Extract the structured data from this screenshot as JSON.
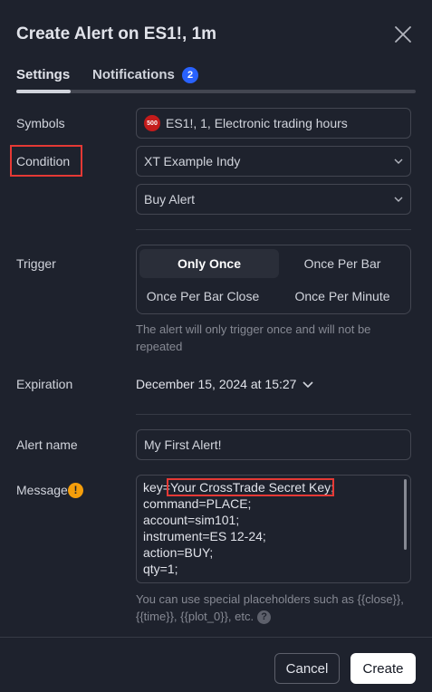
{
  "dialog": {
    "title": "Create Alert on ES1!, 1m",
    "close_icon": "close-icon"
  },
  "tabs": [
    {
      "label": "Settings",
      "active": true
    },
    {
      "label": "Notifications",
      "badge": "2"
    }
  ],
  "symbols": {
    "label": "Symbols",
    "logo_text": "500",
    "value": "ES1!, 1, Electronic trading hours"
  },
  "condition": {
    "label": "Condition",
    "value": "XT Example Indy",
    "sub_value": "Buy Alert"
  },
  "trigger": {
    "label": "Trigger",
    "options": [
      "Only Once",
      "Once Per Bar",
      "Once Per Bar Close",
      "Once Per Minute"
    ],
    "selected": "Only Once",
    "hint_line1": "The alert will only trigger once and will not be",
    "hint_line2": "repeated"
  },
  "expiration": {
    "label": "Expiration",
    "value": "December 15, 2024 at 15:27"
  },
  "alert_name": {
    "label": "Alert name",
    "value": "My First Alert!"
  },
  "message": {
    "label": "Message",
    "warning_icon": "warning-icon",
    "key_prefix": "key=",
    "key_highlight": "Your CrossTrade Secret Key",
    "key_suffix": ";",
    "lines": [
      "command=PLACE;",
      "account=sim101;",
      "instrument=ES 12-24;",
      "action=BUY;",
      "qty=1;"
    ],
    "hint_line1": "You can use special placeholders such as {{close}},",
    "hint_line2": "{{time}}, {{plot_0}}, etc.",
    "help_icon": "help-icon"
  },
  "footer": {
    "cancel_label": "Cancel",
    "create_label": "Create"
  },
  "colors": {
    "background": "#1e222d",
    "border": "#434651",
    "highlight": "#e53935",
    "badge": "#2962ff",
    "warning": "#f59e0b"
  }
}
